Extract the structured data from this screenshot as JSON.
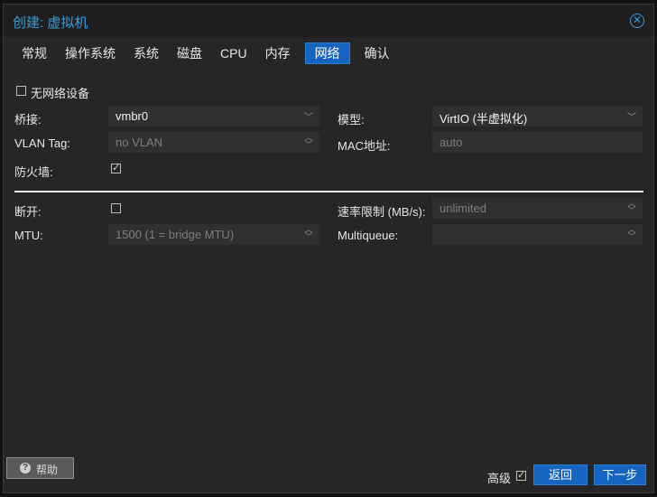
{
  "window": {
    "title": "创建: 虚拟机"
  },
  "tabs": [
    {
      "label": "常规"
    },
    {
      "label": "操作系统"
    },
    {
      "label": "系统"
    },
    {
      "label": "磁盘"
    },
    {
      "label": "CPU"
    },
    {
      "label": "内存"
    },
    {
      "label": "网络",
      "active": true
    },
    {
      "label": "确认"
    }
  ],
  "form": {
    "no_network": {
      "label": "无网络设备",
      "checked": false
    },
    "bridge": {
      "label": "桥接:",
      "value": "vmbr0"
    },
    "model": {
      "label": "模型:",
      "value": "VirtIO (半虚拟化)"
    },
    "vlan": {
      "label": "VLAN Tag:",
      "placeholder": "no VLAN"
    },
    "mac": {
      "label": "MAC地址:",
      "placeholder": "auto"
    },
    "firewall": {
      "label": "防火墙:",
      "checked": true
    },
    "disconnect": {
      "label": "断开:",
      "checked": false
    },
    "rate": {
      "label": "速率限制 (MB/s):",
      "placeholder": "unlimited"
    },
    "mtu": {
      "label": "MTU:",
      "placeholder": "1500 (1 = bridge MTU)"
    },
    "multiqueue": {
      "label": "Multiqueue:",
      "value": ""
    }
  },
  "footer": {
    "help_label": "帮助",
    "advanced_label": "高级",
    "advanced_checked": true,
    "back_label": "返回",
    "next_label": "下一步"
  },
  "colors": {
    "accent": "#1565c0",
    "title": "#3d9bd8",
    "background": "#262626"
  }
}
